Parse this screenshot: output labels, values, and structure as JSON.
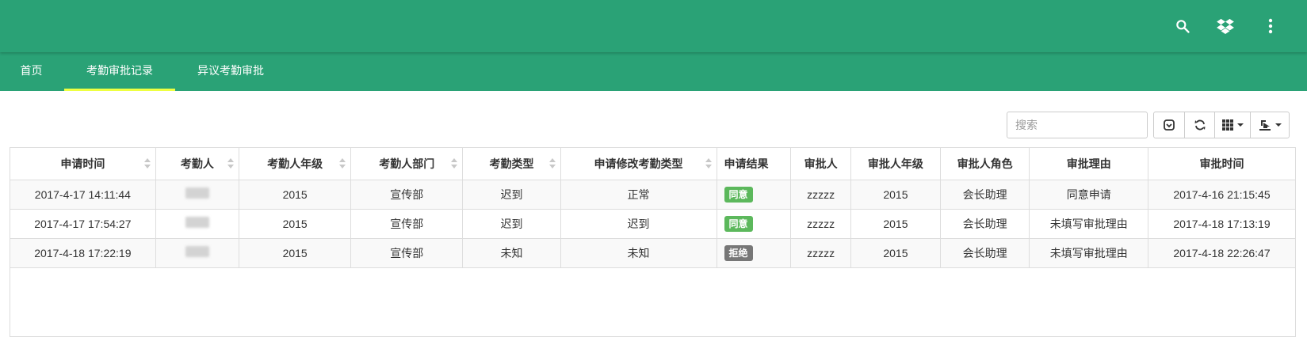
{
  "header": {
    "icons": [
      "search-icon",
      "dropbox-icon",
      "more-vert-icon"
    ],
    "bg_color": "#2aa276"
  },
  "tabs": [
    {
      "label": "首页",
      "active": false
    },
    {
      "label": "考勤审批记录",
      "active": true
    },
    {
      "label": "异议考勤审批",
      "active": false
    }
  ],
  "toolbar": {
    "search_placeholder": "搜索",
    "buttons": [
      "toggle-icon",
      "refresh-icon",
      "columns-icon",
      "export-icon"
    ]
  },
  "table": {
    "columns": [
      "申请时间",
      "考勤人",
      "考勤人年级",
      "考勤人部门",
      "考勤类型",
      "申请修改考勤类型",
      "申请结果",
      "审批人",
      "审批人年级",
      "审批人角色",
      "审批理由",
      "审批时间"
    ],
    "rows": [
      {
        "apply_time": "2017-4-17 14:11:44",
        "grade": "2015",
        "dept": "宣传部",
        "type": "迟到",
        "new_type": "正常",
        "result": "同意",
        "approver": "zzzzz",
        "approver_grade": "2015",
        "approver_role": "会长助理",
        "reason": "同意申请",
        "approve_time": "2017-4-16 21:15:45"
      },
      {
        "apply_time": "2017-4-17 17:54:27",
        "grade": "2015",
        "dept": "宣传部",
        "type": "迟到",
        "new_type": "迟到",
        "result": "同意",
        "approver": "zzzzz",
        "approver_grade": "2015",
        "approver_role": "会长助理",
        "reason": "未填写审批理由",
        "approve_time": "2017-4-18 17:13:19"
      },
      {
        "apply_time": "2017-4-18 17:22:19",
        "grade": "2015",
        "dept": "宣传部",
        "type": "未知",
        "new_type": "未知",
        "result": "拒绝",
        "approver": "zzzzz",
        "approver_grade": "2015",
        "approver_role": "会长助理",
        "reason": "未填写审批理由",
        "approve_time": "2017-4-18 22:26:47"
      }
    ]
  }
}
